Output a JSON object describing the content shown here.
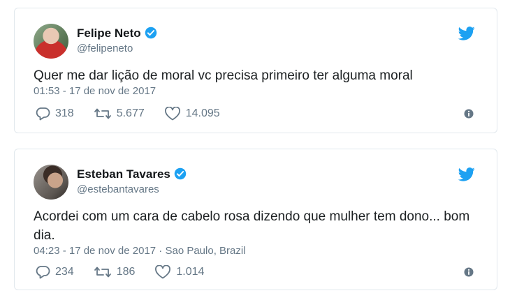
{
  "tweets": [
    {
      "name": "Felipe Neto",
      "handle": "@felipeneto",
      "text": "Quer me dar lição de moral vc precisa primeiro ter alguma moral",
      "meta": "01:53 - 17 de nov de 2017",
      "replies": "318",
      "retweets": "5.677",
      "likes": "14.095",
      "verified": true
    },
    {
      "name": "Esteban Tavares",
      "handle": "@estebantavares",
      "text": "Acordei com um cara de cabelo rosa dizendo que mulher tem dono... bom dia.",
      "meta": "04:23 - 17 de nov de 2017 · Sao Paulo, Brazil",
      "replies": "234",
      "retweets": "186",
      "likes": "1.014",
      "verified": true
    }
  ],
  "icons": {
    "brand": "twitter-bird-icon",
    "verified": "verified-badge-icon",
    "reply": "reply-icon",
    "retweet": "retweet-icon",
    "like": "heart-icon",
    "info": "info-icon"
  },
  "colors": {
    "brand_blue": "#1da1f2",
    "secondary_text": "#657786",
    "border": "#e1e8ed"
  }
}
